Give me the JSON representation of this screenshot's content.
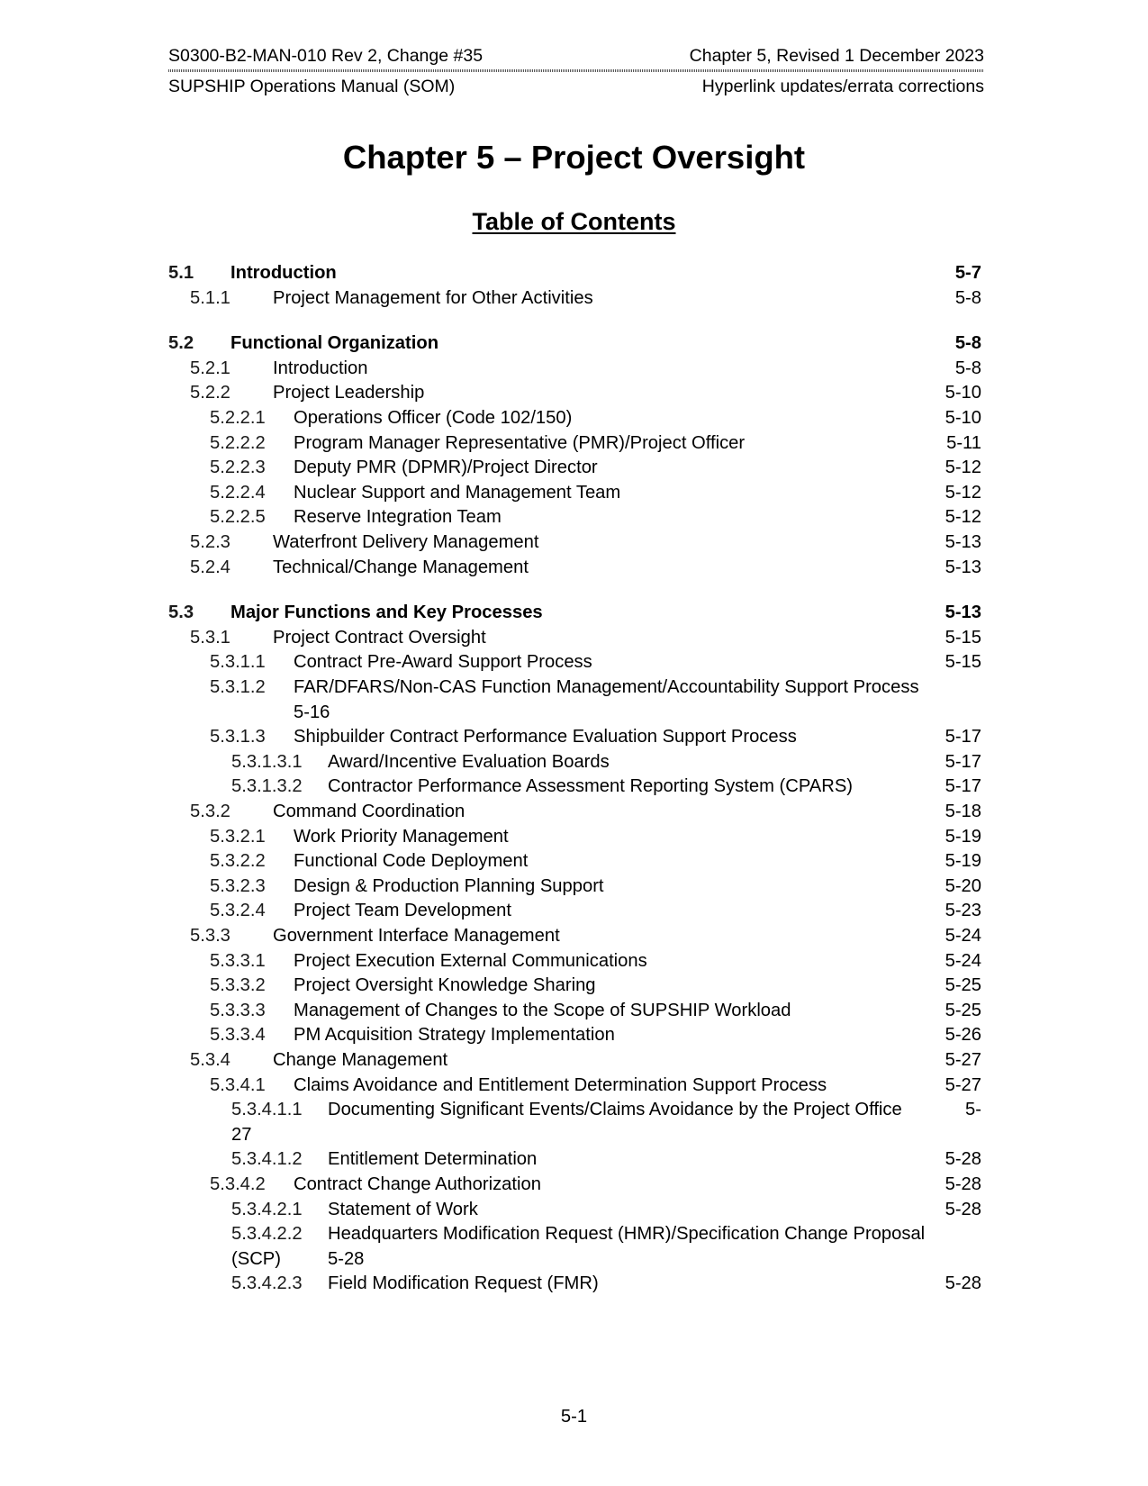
{
  "header": {
    "doc_id": "S0300-B2-MAN-010 Rev 2, Change #35",
    "revision": "Chapter 5, Revised 1 December 2023",
    "manual_name": "SUPSHIP Operations Manual (SOM)",
    "change_note": "Hyperlink updates/errata corrections"
  },
  "title": "Chapter 5 – Project Oversight",
  "toc_heading": "Table of Contents",
  "toc": [
    {
      "num": "5.1",
      "title": "Introduction",
      "page": "5-7",
      "level": 1
    },
    {
      "num": "5.1.1",
      "title": "Project Management for Other Activities",
      "page": "5-8",
      "level": 2
    },
    {
      "num": "5.2",
      "title": "Functional Organization",
      "page": "5-8",
      "level": 1
    },
    {
      "num": "5.2.1",
      "title": "Introduction",
      "page": "5-8",
      "level": 2
    },
    {
      "num": "5.2.2",
      "title": "Project Leadership",
      "page": "5-10",
      "level": 2
    },
    {
      "num": "5.2.2.1",
      "title": "Operations Officer (Code 102/150)",
      "page": "5-10",
      "level": 3
    },
    {
      "num": "5.2.2.2",
      "title": "Program Manager Representative (PMR)/Project Officer",
      "page": "5-11",
      "level": 3
    },
    {
      "num": "5.2.2.3",
      "title": "Deputy PMR (DPMR)/Project Director",
      "page": "5-12",
      "level": 3
    },
    {
      "num": "5.2.2.4",
      "title": "Nuclear Support and Management Team",
      "page": "5-12",
      "level": 3
    },
    {
      "num": "5.2.2.5",
      "title": "Reserve Integration Team",
      "page": "5-12",
      "level": 3
    },
    {
      "num": "5.2.3",
      "title": "Waterfront Delivery Management",
      "page": "5-13",
      "level": 2
    },
    {
      "num": "5.2.4",
      "title": "Technical/Change Management",
      "page": "5-13",
      "level": 2
    },
    {
      "num": "5.3",
      "title": "Major Functions and Key Processes",
      "page": "5-13",
      "level": 1
    },
    {
      "num": "5.3.1",
      "title": "Project Contract Oversight",
      "page": "5-15",
      "level": 2
    },
    {
      "num": "5.3.1.1",
      "title": "Contract Pre-Award Support Process",
      "page": "5-15",
      "level": 3
    },
    {
      "num": "5.3.1.2",
      "title": "FAR/DFARS/Non-CAS Function Management/Accountability Support Process",
      "page": "",
      "continuation": "5-16",
      "level": 3
    },
    {
      "num": "5.3.1.3",
      "title": "Shipbuilder Contract Performance Evaluation Support Process",
      "page": "5-17",
      "level": 3
    },
    {
      "num": "5.3.1.3.1",
      "title": "Award/Incentive Evaluation Boards",
      "page": "5-17",
      "level": 4
    },
    {
      "num": "5.3.1.3.2",
      "title": "Contractor Performance Assessment Reporting System (CPARS)",
      "page": "5-17",
      "level": 4
    },
    {
      "num": "5.3.2",
      "title": "Command Coordination",
      "page": "5-18",
      "level": 2
    },
    {
      "num": "5.3.2.1",
      "title": "Work Priority Management",
      "page": "5-19",
      "level": 3
    },
    {
      "num": "5.3.2.2",
      "title": "Functional Code Deployment",
      "page": "5-19",
      "level": 3
    },
    {
      "num": "5.3.2.3",
      "title": "Design & Production Planning Support",
      "page": "5-20",
      "level": 3
    },
    {
      "num": "5.3.2.4",
      "title": "Project Team Development",
      "page": "5-23",
      "level": 3
    },
    {
      "num": "5.3.3",
      "title": "Government Interface Management",
      "page": "5-24",
      "level": 2
    },
    {
      "num": "5.3.3.1",
      "title": "Project Execution External Communications",
      "page": "5-24",
      "level": 3
    },
    {
      "num": "5.3.3.2",
      "title": "Project Oversight Knowledge Sharing",
      "page": "5-25",
      "level": 3
    },
    {
      "num": "5.3.3.3",
      "title": "Management of Changes to the Scope of SUPSHIP Workload",
      "page": "5-25",
      "level": 3
    },
    {
      "num": "5.3.3.4",
      "title": "PM Acquisition Strategy Implementation",
      "page": "5-26",
      "level": 3
    },
    {
      "num": "5.3.4",
      "title": "Change Management",
      "page": "5-27",
      "level": 2
    },
    {
      "num": "5.3.4.1",
      "title": "Claims Avoidance and Entitlement Determination Support Process",
      "page": "5-27",
      "level": 3
    },
    {
      "num": "5.3.4.1.1",
      "title": "Documenting Significant Events/Claims Avoidance by the Project Office",
      "page": "5-",
      "continuation": "27",
      "level": 4
    },
    {
      "num": "5.3.4.1.2",
      "title": "Entitlement Determination",
      "page": "5-28",
      "level": 4
    },
    {
      "num": "5.3.4.2",
      "title": "Contract Change Authorization",
      "page": "5-28",
      "level": 3
    },
    {
      "num": "5.3.4.2.1",
      "title": "Statement of Work",
      "page": "5-28",
      "level": 4
    },
    {
      "num": "5.3.4.2.2",
      "title": "Headquarters Modification Request (HMR)/Specification Change Proposal",
      "page": "",
      "continuation": "(SCP)",
      "continuation_page": "5-28",
      "level": 4
    },
    {
      "num": "5.3.4.2.3",
      "title": "Field Modification Request (FMR)",
      "page": "5-28",
      "level": 4
    }
  ],
  "footer": {
    "page_number": "5-1"
  }
}
